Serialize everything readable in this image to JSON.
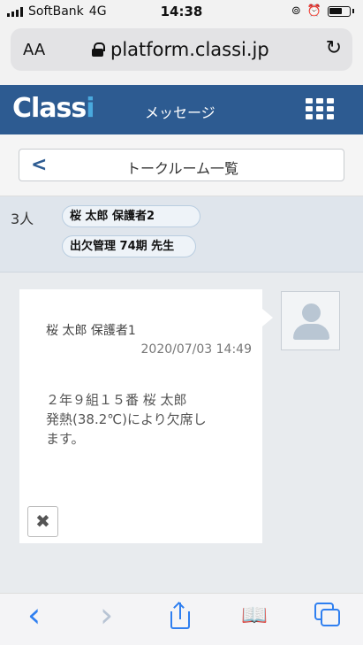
{
  "status_bar": {
    "carrier": "SoftBank",
    "network": "4G",
    "time": "14:38"
  },
  "browser": {
    "text_size_label": "AA",
    "url": "platform.classi.jp"
  },
  "app_header": {
    "logo_text_main": "Class",
    "logo_text_accent": "i",
    "title": "メッセージ"
  },
  "navigation": {
    "room_list_label": "トークルーム一覧"
  },
  "members": {
    "count_label": "3人",
    "tags": [
      "桜 太郎 保護者2",
      "出欠管理 74期 先生"
    ]
  },
  "message": {
    "sender": "桜 太郎 保護者1",
    "timestamp": "2020/07/03 14:49",
    "body_lines": [
      "２年９組１５番 桜 太郎",
      "発熱(38.2℃)により欠席し",
      "ます。"
    ],
    "close_glyph": "✖"
  },
  "toolbar": {
    "back_glyph": "‹",
    "forward_glyph": "›",
    "bookmarks_glyph": "📖"
  },
  "colors": {
    "header_bg": "#2d5b91",
    "accent_blue": "#2f7ff0",
    "logo_accent": "#49a9de"
  }
}
